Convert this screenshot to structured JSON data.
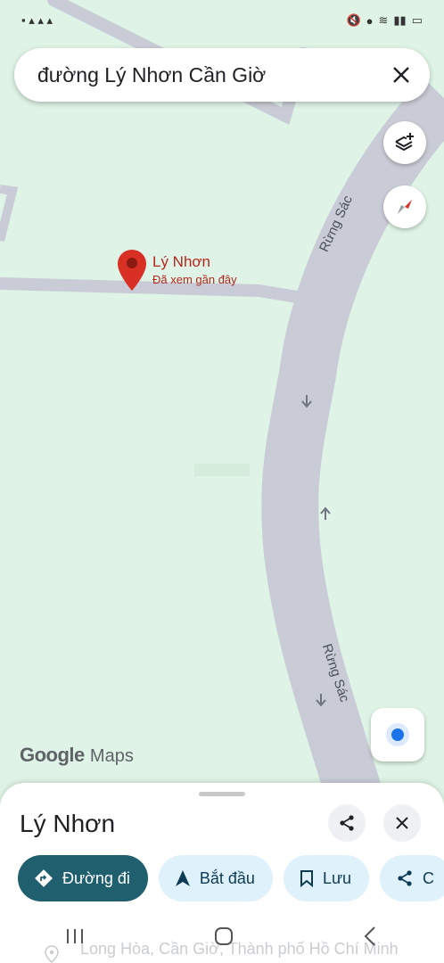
{
  "status_bar": {
    "left_icons": "status-notification-icons",
    "right_icons": "mute-location-wifi-signal-battery"
  },
  "search": {
    "query": "đường Lý Nhơn Cần Giờ",
    "close_icon": "close-icon"
  },
  "map": {
    "pin": {
      "title": "Lý Nhơn",
      "subtitle": "Đã xem gần đây"
    },
    "road_labels": [
      "Rừng Sác",
      "Rừng Sác"
    ],
    "logo_google": "Google",
    "logo_maps": "Maps",
    "colors": {
      "land": "#dff3e6",
      "road": "#c9ccd6",
      "pin": "#d93025",
      "location": "#1a73e8"
    }
  },
  "place_sheet": {
    "title": "Lý Nhơn",
    "actions": [
      {
        "label": "Đường đi",
        "icon": "directions-icon"
      },
      {
        "label": "Bắt đầu",
        "icon": "navigation-arrow-icon"
      },
      {
        "label": "Lưu",
        "icon": "bookmark-icon"
      },
      {
        "label": "C",
        "icon": "share-icon"
      }
    ],
    "address": "Long Hòa, Cần Giờ, Thành phố Hồ Chí Minh"
  }
}
